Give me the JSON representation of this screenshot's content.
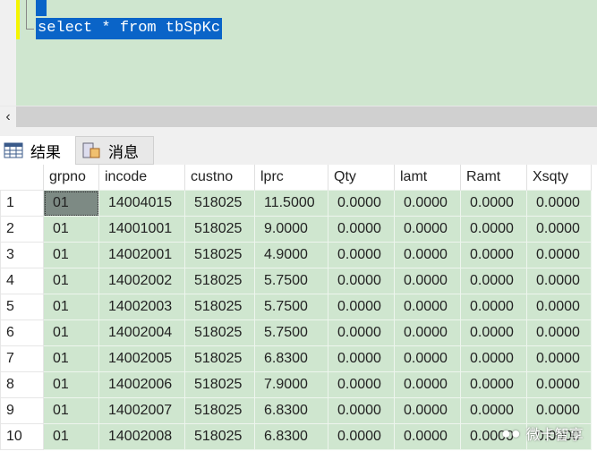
{
  "editor": {
    "sql": "select * from tbSpKc"
  },
  "tabs": [
    {
      "label": "结果",
      "icon": "grid-icon"
    },
    {
      "label": "消息",
      "icon": "message-icon"
    }
  ],
  "grid": {
    "columns": [
      "grpno",
      "incode",
      "custno",
      "lprc",
      "Qty",
      "lamt",
      "Ramt",
      "Xsqty"
    ],
    "rows": [
      [
        "1",
        "01",
        "14004015",
        "518025",
        "11.5000",
        "0.0000",
        "0.0000",
        "0.0000",
        "0.0000"
      ],
      [
        "2",
        "01",
        "14001001",
        "518025",
        "9.0000",
        "0.0000",
        "0.0000",
        "0.0000",
        "0.0000"
      ],
      [
        "3",
        "01",
        "14002001",
        "518025",
        "4.9000",
        "0.0000",
        "0.0000",
        "0.0000",
        "0.0000"
      ],
      [
        "4",
        "01",
        "14002002",
        "518025",
        "5.7500",
        "0.0000",
        "0.0000",
        "0.0000",
        "0.0000"
      ],
      [
        "5",
        "01",
        "14002003",
        "518025",
        "5.7500",
        "0.0000",
        "0.0000",
        "0.0000",
        "0.0000"
      ],
      [
        "6",
        "01",
        "14002004",
        "518025",
        "5.7500",
        "0.0000",
        "0.0000",
        "0.0000",
        "0.0000"
      ],
      [
        "7",
        "01",
        "14002005",
        "518025",
        "6.8300",
        "0.0000",
        "0.0000",
        "0.0000",
        "0.0000"
      ],
      [
        "8",
        "01",
        "14002006",
        "518025",
        "7.9000",
        "0.0000",
        "0.0000",
        "0.0000",
        "0.0000"
      ],
      [
        "9",
        "01",
        "14002007",
        "518025",
        "6.8300",
        "0.0000",
        "0.0000",
        "0.0000",
        "0.0000"
      ],
      [
        "10",
        "01",
        "14002008",
        "518025",
        "6.8300",
        "0.0000",
        "0.0000",
        "0.0000",
        "0.0000"
      ]
    ]
  },
  "watermark": "微卡智享"
}
